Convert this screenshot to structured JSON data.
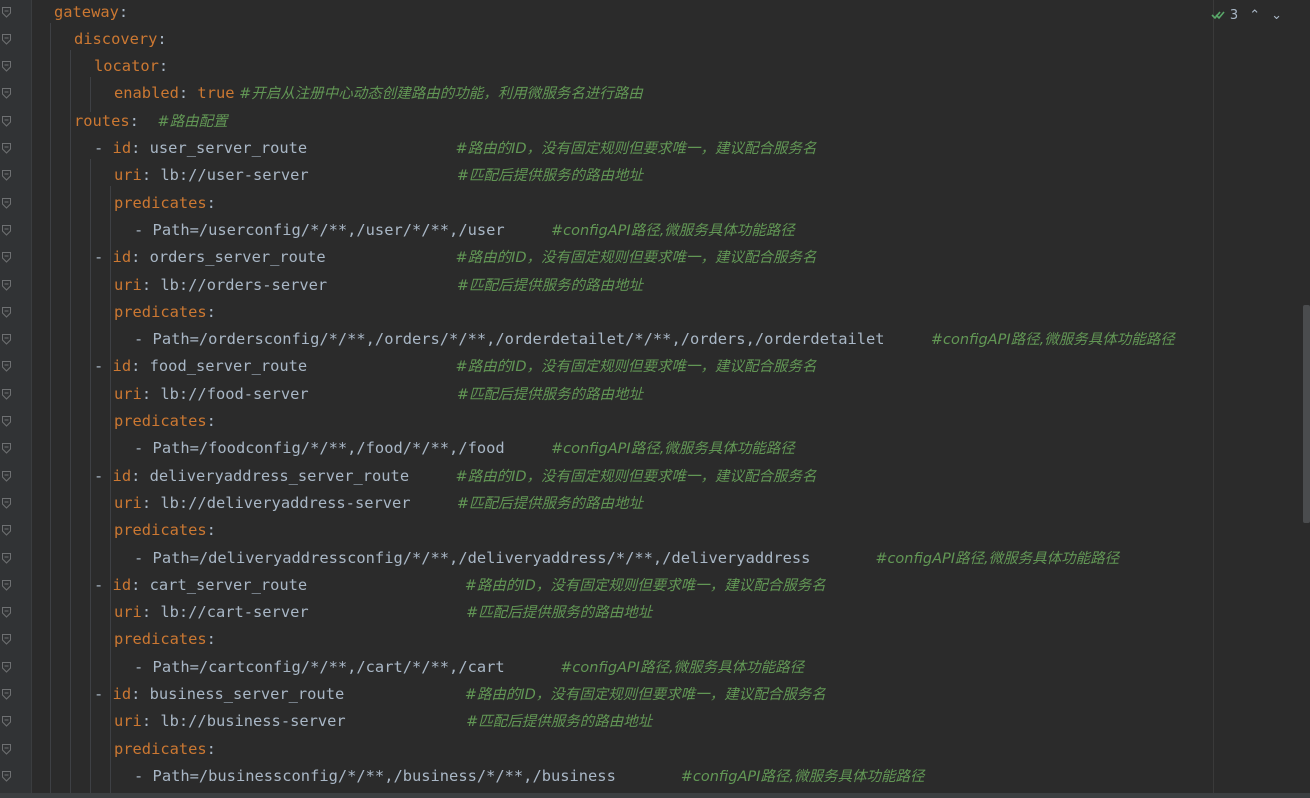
{
  "inspection": {
    "count": "3",
    "check_icon": "check-double-icon",
    "up_icon": "chevron-up-icon",
    "down_icon": "chevron-down-icon"
  },
  "colors": {
    "key": "#cc7832",
    "text": "#a9b7c6",
    "comment": "#629755",
    "background": "#2b2b2b"
  },
  "lines": [
    {
      "indent": 22,
      "key": "gateway",
      "sep": ":",
      "value": "",
      "comment": ""
    },
    {
      "indent": 42,
      "key": "discovery",
      "sep": ":",
      "value": "",
      "comment": ""
    },
    {
      "indent": 62,
      "key": "locator",
      "sep": ":",
      "value": "",
      "comment": ""
    },
    {
      "indent": 82,
      "key": "enabled",
      "sep": ": ",
      "bool": "true",
      "value": "",
      "comment": " #开启从注册中心动态创建路由的功能，利用微服务名进行路由"
    },
    {
      "indent": 42,
      "key": "routes",
      "sep": ":  ",
      "value": "",
      "comment": "#路由配置"
    },
    {
      "indent": 62,
      "dash": "- ",
      "key": "id",
      "sep": ": ",
      "value": "user_server_route",
      "pad": "                ",
      "comment": "#路由的ID，没有固定规则但要求唯一，建议配合服务名"
    },
    {
      "indent": 82,
      "key": "uri",
      "sep": ": ",
      "value": "lb://user-server",
      "pad": "                ",
      "comment": "#匹配后提供服务的路由地址"
    },
    {
      "indent": 82,
      "key": "predicates",
      "sep": ":",
      "value": "",
      "comment": ""
    },
    {
      "indent": 102,
      "dash": "- ",
      "key": "",
      "sep": "",
      "value": "Path=/userconfig/*/**,/user/*/**,/user",
      "pad": "     ",
      "comment": "#configAPI路径,微服务具体功能路径"
    },
    {
      "indent": 62,
      "dash": "- ",
      "key": "id",
      "sep": ": ",
      "value": "orders_server_route",
      "pad": "              ",
      "comment": "#路由的ID，没有固定规则但要求唯一，建议配合服务名"
    },
    {
      "indent": 82,
      "key": "uri",
      "sep": ": ",
      "value": "lb://orders-server",
      "pad": "              ",
      "comment": "#匹配后提供服务的路由地址"
    },
    {
      "indent": 82,
      "key": "predicates",
      "sep": ":",
      "value": "",
      "comment": ""
    },
    {
      "indent": 102,
      "dash": "- ",
      "key": "",
      "sep": "",
      "value": "Path=/ordersconfig/*/**,/orders/*/**,/orderdetailet/*/**,/orders,/orderdetailet",
      "pad": "     ",
      "comment": "#configAPI路径,微服务具体功能路径"
    },
    {
      "indent": 62,
      "dash": "- ",
      "key": "id",
      "sep": ": ",
      "value": "food_server_route",
      "pad": "                ",
      "comment": "#路由的ID，没有固定规则但要求唯一，建议配合服务名"
    },
    {
      "indent": 82,
      "key": "uri",
      "sep": ": ",
      "value": "lb://food-server",
      "pad": "                ",
      "comment": "#匹配后提供服务的路由地址"
    },
    {
      "indent": 82,
      "key": "predicates",
      "sep": ":",
      "value": "",
      "comment": ""
    },
    {
      "indent": 102,
      "dash": "- ",
      "key": "",
      "sep": "",
      "value": "Path=/foodconfig/*/**,/food/*/**,/food",
      "pad": "     ",
      "comment": "#configAPI路径,微服务具体功能路径"
    },
    {
      "indent": 62,
      "dash": "- ",
      "key": "id",
      "sep": ": ",
      "value": "deliveryaddress_server_route",
      "pad": "     ",
      "comment": "#路由的ID，没有固定规则但要求唯一，建议配合服务名"
    },
    {
      "indent": 82,
      "key": "uri",
      "sep": ": ",
      "value": "lb://deliveryaddress-server",
      "pad": "     ",
      "comment": "#匹配后提供服务的路由地址"
    },
    {
      "indent": 82,
      "key": "predicates",
      "sep": ":",
      "value": "",
      "comment": ""
    },
    {
      "indent": 102,
      "dash": "- ",
      "key": "",
      "sep": "",
      "value": "Path=/deliveryaddressconfig/*/**,/deliveryaddress/*/**,/deliveryaddress",
      "pad": "       ",
      "comment": "#configAPI路径,微服务具体功能路径"
    },
    {
      "indent": 62,
      "dash": "- ",
      "key": "id",
      "sep": ": ",
      "value": "cart_server_route",
      "pad": "                 ",
      "comment": "#路由的ID，没有固定规则但要求唯一，建议配合服务名"
    },
    {
      "indent": 82,
      "key": "uri",
      "sep": ": ",
      "value": "lb://cart-server",
      "pad": "                 ",
      "comment": "#匹配后提供服务的路由地址"
    },
    {
      "indent": 82,
      "key": "predicates",
      "sep": ":",
      "value": "",
      "comment": ""
    },
    {
      "indent": 102,
      "dash": "- ",
      "key": "",
      "sep": "",
      "value": "Path=/cartconfig/*/**,/cart/*/**,/cart",
      "pad": "      ",
      "comment": "#configAPI路径,微服务具体功能路径"
    },
    {
      "indent": 62,
      "dash": "- ",
      "key": "id",
      "sep": ": ",
      "value": "business_server_route",
      "pad": "             ",
      "comment": "#路由的ID，没有固定规则但要求唯一，建议配合服务名"
    },
    {
      "indent": 82,
      "key": "uri",
      "sep": ": ",
      "value": "lb://business-server",
      "pad": "             ",
      "comment": "#匹配后提供服务的路由地址"
    },
    {
      "indent": 82,
      "key": "predicates",
      "sep": ":",
      "value": "",
      "comment": ""
    },
    {
      "indent": 102,
      "dash": "- ",
      "key": "",
      "sep": "",
      "value": "Path=/businessconfig/*/**,/business/*/**,/business",
      "pad": "       ",
      "comment": "#configAPI路径,微服务具体功能路径"
    }
  ]
}
